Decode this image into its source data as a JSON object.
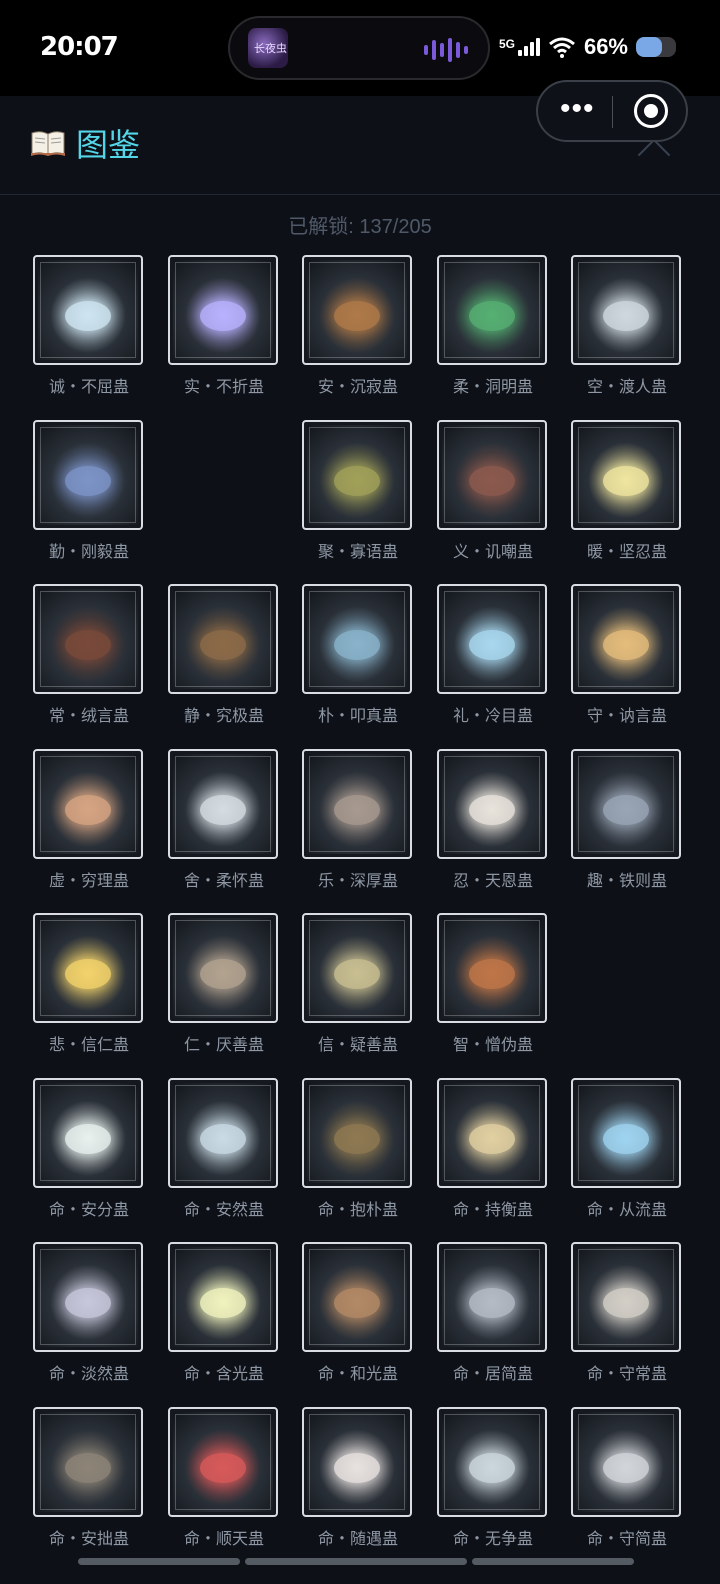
{
  "status_bar": {
    "time": "20:07",
    "island_app_text": "长夜虫",
    "network": "5G",
    "battery_percent": "66%",
    "battery_level": 0.66
  },
  "header": {
    "title": "图鉴",
    "icon": "book-icon",
    "menu_icon": "more-dots-icon",
    "target_icon": "target-icon",
    "close_icon": "close-icon"
  },
  "unlocked_text": "已解锁: 137/205",
  "colors": {
    "title": "#54d6e8",
    "background": "#0d1017"
  },
  "items": [
    {
      "label": "诚・不屈蛊",
      "color": "#cfe6f2"
    },
    {
      "label": "实・不折蛊",
      "color": "#b9b2ff"
    },
    {
      "label": "安・沉寂蛊",
      "color": "#b07a48"
    },
    {
      "label": "柔・洞明蛊",
      "color": "#56b073"
    },
    {
      "label": "空・渡人蛊",
      "color": "#cfd9df"
    },
    {
      "label": "勤・刚毅蛊",
      "color": "#7d94c8"
    },
    null,
    {
      "label": "聚・寡语蛊",
      "color": "#a3a25a"
    },
    {
      "label": "义・讥嘲蛊",
      "color": "#8c5a4e"
    },
    {
      "label": "暖・坚忍蛊",
      "color": "#f0e6a0"
    },
    {
      "label": "常・绒言蛊",
      "color": "#7a4a3a"
    },
    {
      "label": "静・究极蛊",
      "color": "#8d6b48"
    },
    {
      "label": "朴・叩真蛊",
      "color": "#8ab4cc"
    },
    {
      "label": "礼・冷目蛊",
      "color": "#a9d8ef"
    },
    {
      "label": "守・讷言蛊",
      "color": "#e5bd7c"
    },
    {
      "label": "虚・穷理蛊",
      "color": "#d7a583"
    },
    {
      "label": "舍・柔怀蛊",
      "color": "#d6dde2"
    },
    {
      "label": "乐・深厚蛊",
      "color": "#a89a90"
    },
    {
      "label": "忍・天恩蛊",
      "color": "#e9e4dc"
    },
    {
      "label": "趣・铁则蛊",
      "color": "#9aa6b6"
    },
    {
      "label": "悲・信仁蛊",
      "color": "#f3d36b"
    },
    {
      "label": "仁・厌善蛊",
      "color": "#b3a390"
    },
    {
      "label": "信・疑善蛊",
      "color": "#c9bf92"
    },
    {
      "label": "智・憎伪蛊",
      "color": "#c07648"
    },
    null,
    {
      "label": "命・安分蛊",
      "color": "#e8f1ee"
    },
    {
      "label": "命・安然蛊",
      "color": "#c9dbe6"
    },
    {
      "label": "命・抱朴蛊",
      "color": "#8f7a52"
    },
    {
      "label": "命・持衡蛊",
      "color": "#e2d0a2"
    },
    {
      "label": "命・从流蛊",
      "color": "#9fd4f0"
    },
    {
      "label": "命・淡然蛊",
      "color": "#c8c8dc"
    },
    {
      "label": "命・含光蛊",
      "color": "#f1f4be"
    },
    {
      "label": "命・和光蛊",
      "color": "#b48a66"
    },
    {
      "label": "命・居简蛊",
      "color": "#b5bcc6"
    },
    {
      "label": "命・守常蛊",
      "color": "#d4d0c8"
    },
    {
      "label": "命・安拙蛊",
      "color": "#8e8578"
    },
    {
      "label": "命・顺天蛊",
      "color": "#d95a5a"
    },
    {
      "label": "命・随遇蛊",
      "color": "#e8e2e0"
    },
    {
      "label": "命・无争蛊",
      "color": "#cdd8de"
    },
    {
      "label": "命・守简蛊",
      "color": "#d3d6da"
    }
  ]
}
